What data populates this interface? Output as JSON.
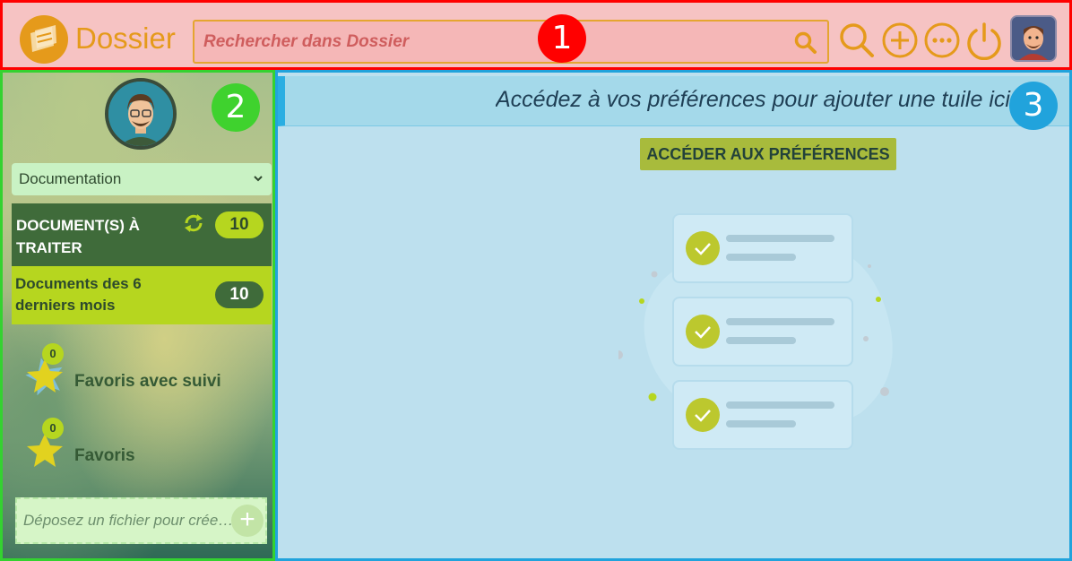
{
  "header": {
    "app_name": "Dossier",
    "search_placeholder": "Rechercher dans Dossier",
    "zone_badge": "1"
  },
  "sidebar": {
    "zone_badge": "2",
    "profile_select": "Documentation",
    "todo": {
      "label": "DOCUMENT(S) À TRAITER",
      "count": "10"
    },
    "recent": {
      "label": "Documents des 6 derniers mois",
      "count": "10"
    },
    "favorites_followed": {
      "label": "Favoris avec suivi",
      "count": "0"
    },
    "favorites": {
      "label": "Favoris",
      "count": "0"
    },
    "dropzone_text": "Déposez un fichier pour créer un document"
  },
  "main": {
    "zone_badge": "3",
    "banner_text": "Accédez à vos préférences pour ajouter une tuile ici",
    "pref_button": "ACCÉDER AUX PRÉFÉRENCES"
  },
  "colors": {
    "header_accent": "#e59a1b",
    "zone1_border": "#ff0000",
    "zone2_border": "#34d230",
    "zone3_border": "#21a3dc",
    "todo_bg": "#3f6b3a",
    "recent_bg": "#b6d61f",
    "pref_button_bg": "#a8bb3c"
  },
  "icons": [
    "logo-icon",
    "search-icon",
    "zoom-search-icon",
    "plus-circle-icon",
    "more-circle-icon",
    "power-icon",
    "user-avatar-icon",
    "refresh-icon",
    "chevron-down-icon",
    "star-icon",
    "add-icon",
    "checklist-illustration"
  ]
}
